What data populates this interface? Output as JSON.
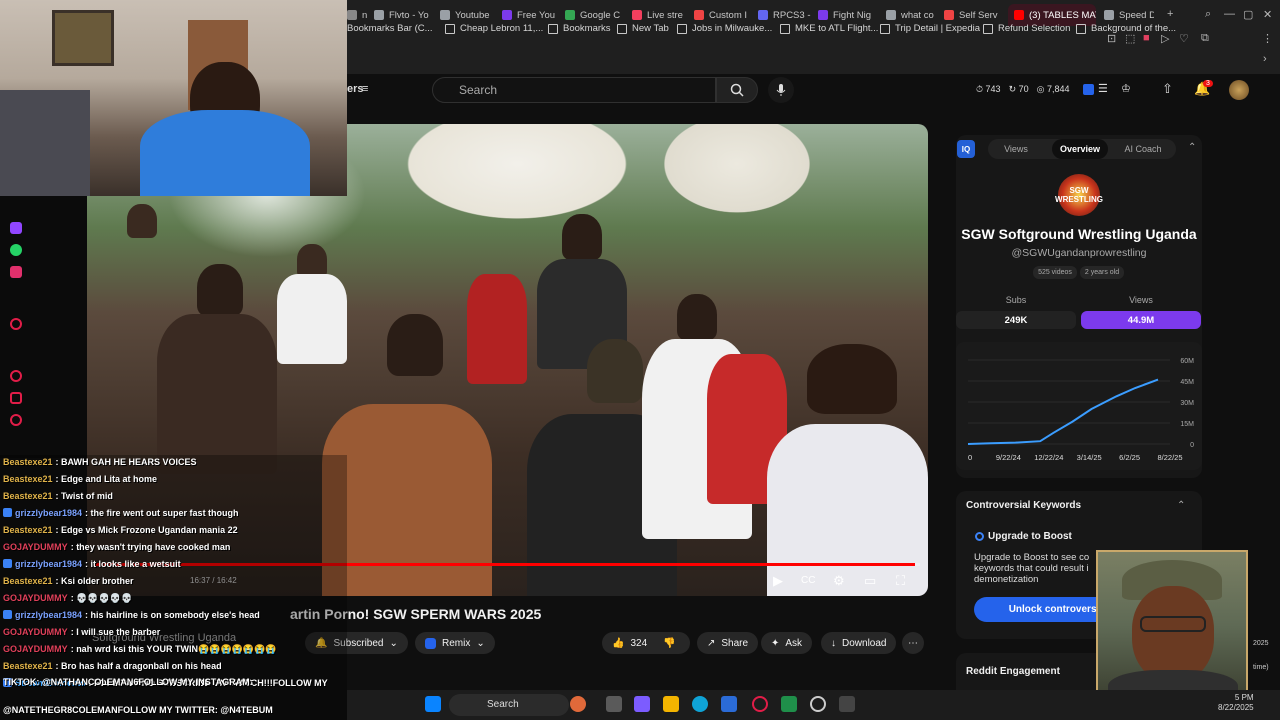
{
  "browser": {
    "tabs": [
      {
        "label": "n",
        "color": "#888888"
      },
      {
        "label": "Flvto - Yo",
        "color": "#9aa0a6"
      },
      {
        "label": "Youtube",
        "color": "#9aa0a6"
      },
      {
        "label": "Free You",
        "color": "#7c3aed"
      },
      {
        "label": "Google C",
        "color": "#34a853"
      },
      {
        "label": "Live stre",
        "color": "#f43f5e"
      },
      {
        "label": "Custom I",
        "color": "#ef4444"
      },
      {
        "label": "RPCS3 -",
        "color": "#6366f1"
      },
      {
        "label": "Fight Nig",
        "color": "#7c3aed"
      },
      {
        "label": "what co",
        "color": "#9aa0a6"
      },
      {
        "label": "Self Serv",
        "color": "#ef4444"
      },
      {
        "label": "(3) TABLES MAT",
        "color": "#ff0000"
      },
      {
        "label": "Speed D",
        "color": "#9aa0a6"
      }
    ],
    "bookmarks": [
      "Bookmarks Bar (C...",
      "Cheap Lebron 11,...",
      "Bookmarks",
      "New Tab",
      "Jobs in Milwauke...",
      "MKE to ATL Flight...",
      "Trip Detail | Expedia",
      "Refund Selection",
      "Background of the..."
    ]
  },
  "youtube": {
    "filters_label": "ers",
    "search_placeholder": "Search",
    "header_stats": {
      "a": "743",
      "b": "70",
      "c": "7,844"
    },
    "notification_count": "3"
  },
  "video": {
    "title": "artin Porno! SGW SPERM WARS 2025",
    "time": "16:37 / 16:42",
    "progress": 0.994,
    "channel_below": "Softground Wrestling Uganda",
    "subscribe_label": "Subscribed",
    "remix_label": "Remix",
    "likes": "324",
    "share_label": "Share",
    "ask_label": "Ask",
    "download_label": "Download"
  },
  "panel": {
    "tabs": [
      "Views",
      "Overview",
      "AI Coach"
    ],
    "active_tab": "Overview",
    "badge": "IQ",
    "logo_text": "SGW WRESTLING",
    "channel_name": "SGW Softground Wrestling Uganda",
    "handle": "@SGWUgandanprowrestling",
    "chips": [
      "525 videos",
      "2 years old"
    ],
    "subs_label": "Subs",
    "subs_value": "249K",
    "views_label": "Views",
    "views_value": "44.9M",
    "accent_color": "#7c3aed",
    "keywords_title": "Controversial Keywords",
    "boost_title": "Upgrade to Boost",
    "boost_text": "Upgrade to Boost to see co keywords that could result i demonetization",
    "unlock_label": "Unlock controversi",
    "reddit_title": "Reddit Engagement"
  },
  "chart_data": {
    "type": "line",
    "x": [
      "9/22/24",
      "12/22/24",
      "3/14/25",
      "6/2/25",
      "8/22/25"
    ],
    "x_tick_labels": [
      "0",
      "9/22/24",
      "12/22/24",
      "3/14/25",
      "6/2/25",
      "8/22/25"
    ],
    "y_tick_labels": [
      "60M",
      "45M",
      "30M",
      "15M",
      "0"
    ],
    "ylim": [
      0,
      60
    ],
    "series": [
      {
        "points": [
          [
            0,
            0
          ],
          [
            0.12,
            0.5
          ],
          [
            0.25,
            1
          ],
          [
            0.38,
            2
          ],
          [
            0.45,
            8
          ],
          [
            0.55,
            16
          ],
          [
            0.65,
            25
          ],
          [
            0.78,
            34
          ],
          [
            0.88,
            40
          ],
          [
            1.0,
            46
          ]
        ]
      }
    ],
    "line_color": "#3b9dff"
  },
  "chat": [
    {
      "user": "Beastexe21",
      "text": "BAWH GAH HE HEARS VOICES",
      "color": "#e0b34a",
      "icon": false
    },
    {
      "user": "Beastexe21",
      "text": "Edge and Lita at home",
      "color": "#e0b34a",
      "icon": false
    },
    {
      "user": "Beastexe21",
      "text": "Twist of mid",
      "color": "#e0b34a",
      "icon": false
    },
    {
      "user": "grizzlybear1984",
      "text": "the fire went out super fast though",
      "color": "#7aa2ff",
      "icon": true
    },
    {
      "user": "Beastexe21",
      "text": "Edge vs Mick Frozone Ugandan mania 22",
      "color": "#e0b34a",
      "icon": false
    },
    {
      "user": "GOJAYDUMMY",
      "text": "they wasn't trying have cooked man",
      "color": "#e0405a",
      "icon": false
    },
    {
      "user": "grizzlybear1984",
      "text": "it looks like a wetsuit",
      "color": "#7aa2ff",
      "icon": true
    },
    {
      "user": "Beastexe21",
      "text": "Ksi older brother",
      "color": "#e0b34a",
      "icon": false
    },
    {
      "user": "GOJAYDUMMY",
      "text": "💀💀💀💀💀",
      "color": "#e0405a",
      "icon": false
    },
    {
      "user": "grizzlybear1984",
      "text": "his hairline is on somebody else's head",
      "color": "#7aa2ff",
      "icon": true
    },
    {
      "user": "GOJAYDUMMY",
      "text": "I will sue the barber",
      "color": "#e0405a",
      "icon": false
    },
    {
      "user": "GOJAYDUMMY",
      "text": "nah wrd ksi this YOUR TWIN😭😭😭😭😭😭😭",
      "color": "#e0405a",
      "icon": false
    },
    {
      "user": "Beastexe21",
      "text": "Bro has half a dragonball on his head",
      "color": "#e0b34a",
      "icon": false
    },
    {
      "user": "StreamElements",
      "text": "FOLLOW AND SUBSCRIBE ON TWITCH!!!FOLLOW MY",
      "color": "#3ea6ff",
      "icon": true
    }
  ],
  "chat_footer_1": "TIKTOK: @NATHANCOLEMAN6FOLLOW MY INSTAGRAM:",
  "chat_footer_2": "@NATETHEGR8COLEMANFOLLOW MY TWITTER: @N4TEBUM",
  "taskbar": {
    "search_label": "Search",
    "time": "5 PM",
    "date": "8/22/2025",
    "side_year": "2025",
    "side_note": "time)"
  }
}
